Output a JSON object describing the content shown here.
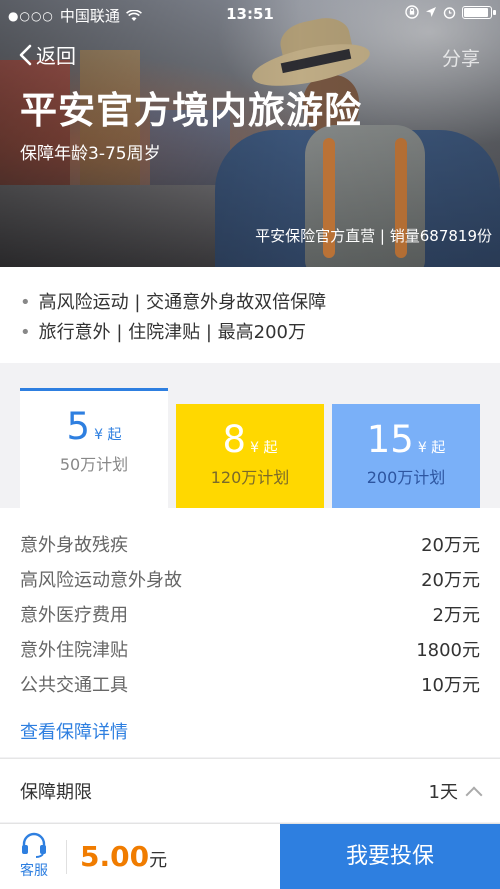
{
  "status_bar": {
    "signal_dots": "●○○○",
    "carrier": "中国联通",
    "time": "13:51"
  },
  "nav": {
    "back_label": "返回",
    "share_label": "分享"
  },
  "hero": {
    "title": "平安官方境内旅游险",
    "subtitle": "保障年龄3-75周岁",
    "seller": "平安保险官方直营 | 销量687819份"
  },
  "highlights": [
    "高风险运动 | 交通意外身故双倍保障",
    "旅行意外 | 住院津贴 | 最高200万"
  ],
  "plans": [
    {
      "price": "5",
      "unit": "¥ 起",
      "name": "50万计划"
    },
    {
      "price": "8",
      "unit": "¥ 起",
      "name": "120万计划"
    },
    {
      "price": "15",
      "unit": "¥ 起",
      "name": "200万计划"
    }
  ],
  "coverage": {
    "items": [
      {
        "label": "意外身故残疾",
        "value": "20万元"
      },
      {
        "label": "高风险运动意外身故",
        "value": "20万元"
      },
      {
        "label": "意外医疗费用",
        "value": "2万元"
      },
      {
        "label": "意外住院津贴",
        "value": "1800元"
      },
      {
        "label": "公共交通工具",
        "value": "10万元"
      }
    ],
    "detail_link": "查看保障详情"
  },
  "period": {
    "label": "保障期限",
    "value": "1天"
  },
  "bottom": {
    "service_label": "客服",
    "price": "5.00",
    "currency": "元",
    "buy_label": "我要投保"
  },
  "colors": {
    "accent": "#2e7fe0",
    "plan2": "#ffd800",
    "plan3": "#7ab0f8",
    "price": "#f07c00"
  }
}
